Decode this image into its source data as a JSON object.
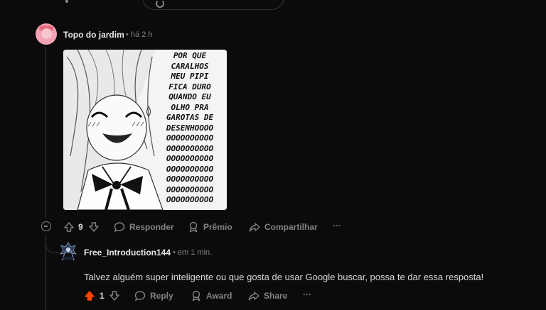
{
  "comment": {
    "username": "Topo do jardim",
    "separator": "•",
    "time": "há 2 h",
    "image_text_lines": [
      "POR QUE",
      "CARALHOS",
      "MEU PIPI",
      "FICA DURO",
      "QUANDO EU",
      "OLHO PRA",
      "GAROTAS DE",
      "DESENHOOOO",
      "OOOOOOOOOO",
      "OOOOOOOOOO",
      "OOOOOOOOOO",
      "OOOOOOOOOO",
      "OOOOOOOOOO",
      "OOOOOOOOOO",
      "OOOOOOOOOO"
    ],
    "actions": {
      "votes": "9",
      "reply": "Responder",
      "award": "Prêmio",
      "share": "Compartilhar",
      "more": "···"
    }
  },
  "reply": {
    "username": "Free_Introduction144",
    "separator": "•",
    "time": "em 1 min.",
    "body": "Talvez alguém super inteligente ou que gosta de usar Google buscar, possa te dar essa resposta!",
    "actions": {
      "votes": "1",
      "reply": "Reply",
      "award": "Award",
      "share": "Share",
      "more": "···"
    }
  },
  "colors": {
    "background": "#0b0b0b",
    "upvoted": "#ff4500",
    "muted": "#818384"
  },
  "icons": [
    "upvote-icon",
    "downvote-icon",
    "comment-icon",
    "award-icon",
    "share-icon",
    "collapse-icon",
    "more-icon"
  ]
}
